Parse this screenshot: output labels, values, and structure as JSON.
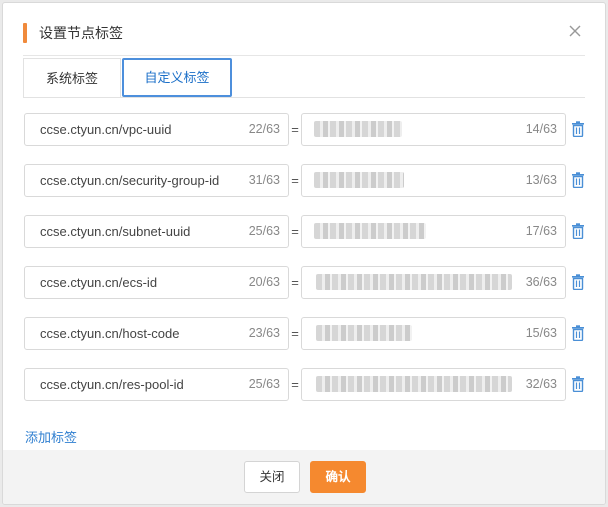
{
  "dialog": {
    "title": "设置节点标签",
    "accent_color": "#f08a3c"
  },
  "tabs": [
    {
      "label": "系统标签",
      "active": false
    },
    {
      "label": "自定义标签",
      "active": true
    }
  ],
  "labels": [
    {
      "key": "ccse.ctyun.cn/vpc-uuid",
      "key_count": "22/63",
      "value_count": "14/63"
    },
    {
      "key": "ccse.ctyun.cn/security-group-id",
      "key_count": "31/63",
      "value_count": "13/63"
    },
    {
      "key": "ccse.ctyun.cn/subnet-uuid",
      "key_count": "25/63",
      "value_count": "17/63"
    },
    {
      "key": "ccse.ctyun.cn/ecs-id",
      "key_count": "20/63",
      "value_count": "36/63"
    },
    {
      "key": "ccse.ctyun.cn/host-code",
      "key_count": "23/63",
      "value_count": "15/63"
    },
    {
      "key": "ccse.ctyun.cn/res-pool-id",
      "key_count": "25/63",
      "value_count": "32/63"
    }
  ],
  "separator": "=",
  "add_label": "添加标签",
  "footer": {
    "close_label": "关闭",
    "confirm_label": "确认",
    "confirm_color": "#f5892f"
  },
  "icons": {
    "close": "close-icon",
    "delete": "trash-icon"
  }
}
